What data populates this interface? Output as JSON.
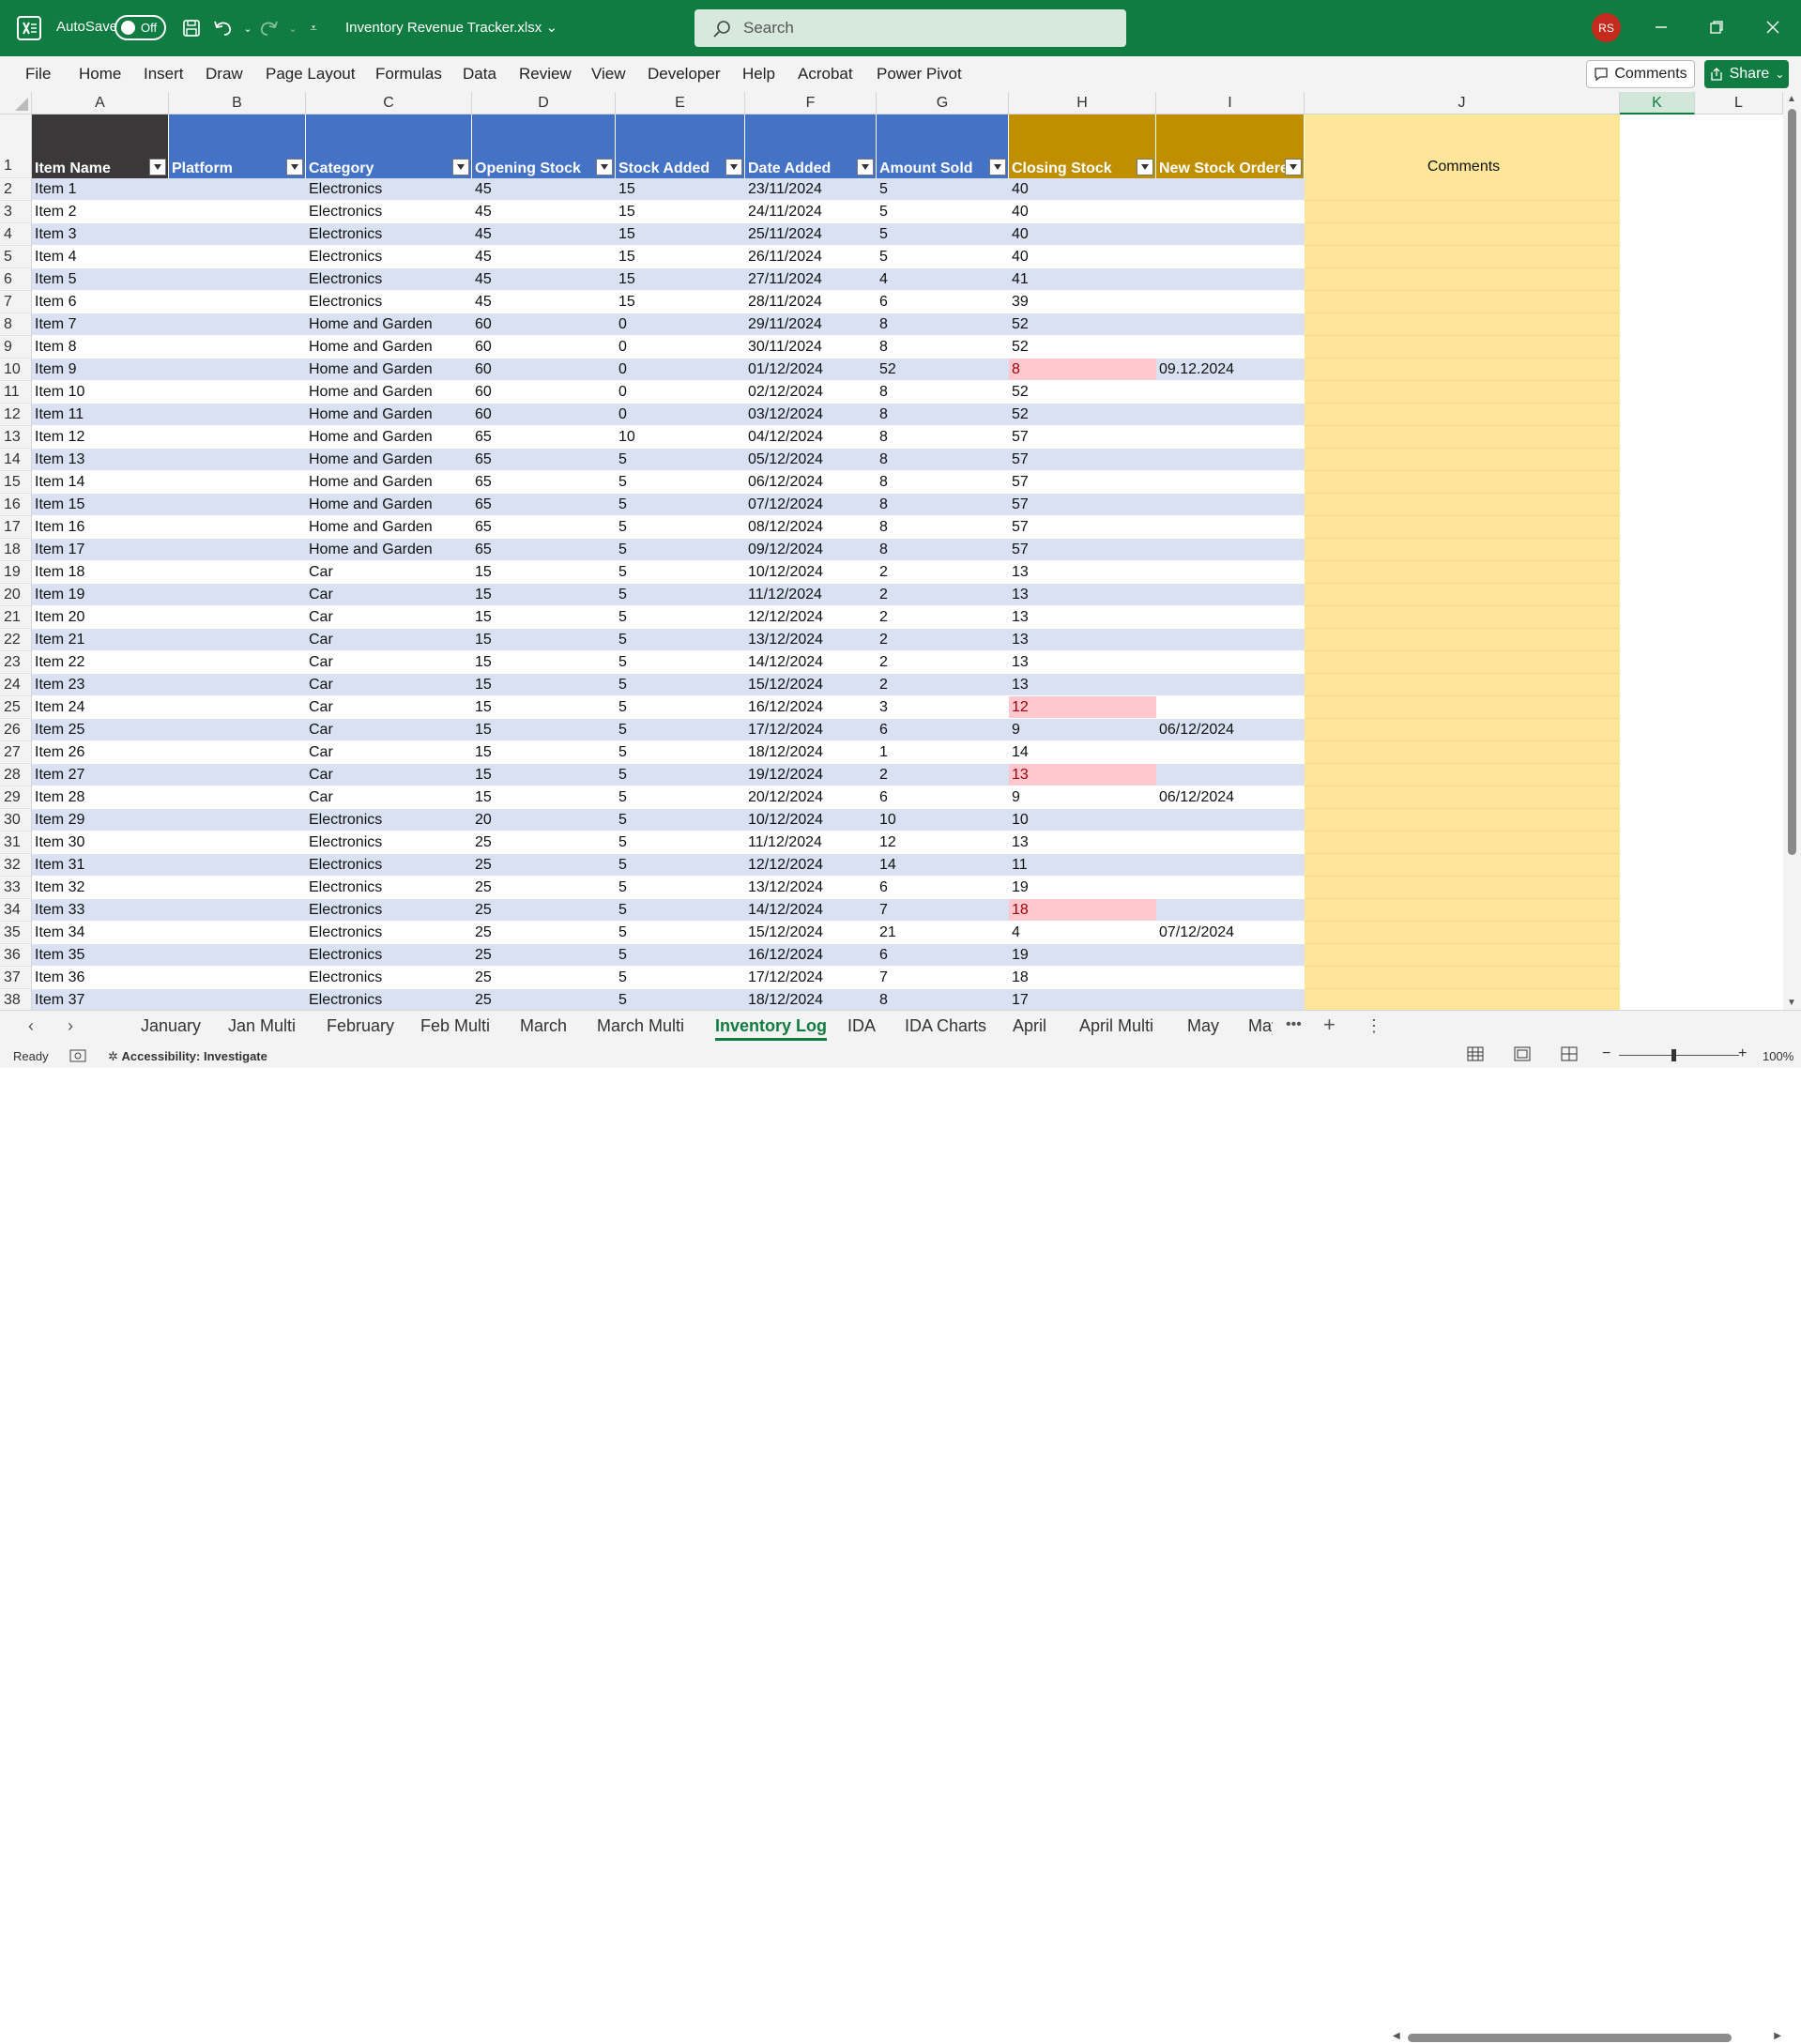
{
  "app": {
    "autosave_label": "AutoSave",
    "autosave_state": "Off",
    "filename": "Inventory Revenue Tracker.xlsx",
    "search_placeholder": "Search",
    "user_initials": "RS"
  },
  "menu": {
    "items": [
      "File",
      "Home",
      "Insert",
      "Draw",
      "Page Layout",
      "Formulas",
      "Data",
      "Review",
      "View",
      "Developer",
      "Help",
      "Acrobat",
      "Power Pivot"
    ],
    "comments_label": "Comments",
    "share_label": "Share"
  },
  "grid": {
    "column_letters": [
      "A",
      "B",
      "C",
      "D",
      "E",
      "F",
      "G",
      "H",
      "I",
      "J",
      "K",
      "L"
    ],
    "selected_column": "K",
    "headers": [
      "Item Name",
      "Platform",
      "Category",
      "Opening Stock",
      "Stock Added",
      "Date Added",
      "Amount Sold",
      "Closing Stock",
      "New Stock Ordered",
      "Comments"
    ],
    "rows": [
      [
        "Item 1",
        "",
        "Electronics",
        "45",
        "15",
        "23/11/2024",
        "5",
        "40",
        ""
      ],
      [
        "Item 2",
        "",
        "Electronics",
        "45",
        "15",
        "24/11/2024",
        "5",
        "40",
        ""
      ],
      [
        "Item 3",
        "",
        "Electronics",
        "45",
        "15",
        "25/11/2024",
        "5",
        "40",
        ""
      ],
      [
        "Item 4",
        "",
        "Electronics",
        "45",
        "15",
        "26/11/2024",
        "5",
        "40",
        ""
      ],
      [
        "Item 5",
        "",
        "Electronics",
        "45",
        "15",
        "27/11/2024",
        "4",
        "41",
        ""
      ],
      [
        "Item 6",
        "",
        "Electronics",
        "45",
        "15",
        "28/11/2024",
        "6",
        "39",
        ""
      ],
      [
        "Item 7",
        "",
        "Home and Garden",
        "60",
        "0",
        "29/11/2024",
        "8",
        "52",
        ""
      ],
      [
        "Item 8",
        "",
        "Home and Garden",
        "60",
        "0",
        "30/11/2024",
        "8",
        "52",
        ""
      ],
      [
        "Item 9",
        "",
        "Home and Garden",
        "60",
        "0",
        "01/12/2024",
        "52",
        "8",
        "09.12.2024"
      ],
      [
        "Item 10",
        "",
        "Home and Garden",
        "60",
        "0",
        "02/12/2024",
        "8",
        "52",
        ""
      ],
      [
        "Item 11",
        "",
        "Home and Garden",
        "60",
        "0",
        "03/12/2024",
        "8",
        "52",
        ""
      ],
      [
        "Item 12",
        "",
        "Home and Garden",
        "65",
        "10",
        "04/12/2024",
        "8",
        "57",
        ""
      ],
      [
        "Item 13",
        "",
        "Home and Garden",
        "65",
        "5",
        "05/12/2024",
        "8",
        "57",
        ""
      ],
      [
        "Item 14",
        "",
        "Home and Garden",
        "65",
        "5",
        "06/12/2024",
        "8",
        "57",
        ""
      ],
      [
        "Item 15",
        "",
        "Home and Garden",
        "65",
        "5",
        "07/12/2024",
        "8",
        "57",
        ""
      ],
      [
        "Item 16",
        "",
        "Home and Garden",
        "65",
        "5",
        "08/12/2024",
        "8",
        "57",
        ""
      ],
      [
        "Item 17",
        "",
        "Home and Garden",
        "65",
        "5",
        "09/12/2024",
        "8",
        "57",
        ""
      ],
      [
        "Item 18",
        "",
        "Car",
        "15",
        "5",
        "10/12/2024",
        "2",
        "13",
        ""
      ],
      [
        "Item 19",
        "",
        "Car",
        "15",
        "5",
        "11/12/2024",
        "2",
        "13",
        ""
      ],
      [
        "Item 20",
        "",
        "Car",
        "15",
        "5",
        "12/12/2024",
        "2",
        "13",
        ""
      ],
      [
        "Item 21",
        "",
        "Car",
        "15",
        "5",
        "13/12/2024",
        "2",
        "13",
        ""
      ],
      [
        "Item 22",
        "",
        "Car",
        "15",
        "5",
        "14/12/2024",
        "2",
        "13",
        ""
      ],
      [
        "Item 23",
        "",
        "Car",
        "15",
        "5",
        "15/12/2024",
        "2",
        "13",
        ""
      ],
      [
        "Item 24",
        "",
        "Car",
        "15",
        "5",
        "16/12/2024",
        "3",
        "12",
        ""
      ],
      [
        "Item 25",
        "",
        "Car",
        "15",
        "5",
        "17/12/2024",
        "6",
        "9",
        "06/12/2024"
      ],
      [
        "Item 26",
        "",
        "Car",
        "15",
        "5",
        "18/12/2024",
        "1",
        "14",
        ""
      ],
      [
        "Item 27",
        "",
        "Car",
        "15",
        "5",
        "19/12/2024",
        "2",
        "13",
        ""
      ],
      [
        "Item 28",
        "",
        "Car",
        "15",
        "5",
        "20/12/2024",
        "6",
        "9",
        "06/12/2024"
      ],
      [
        "Item 29",
        "",
        "Electronics",
        "20",
        "5",
        "10/12/2024",
        "10",
        "10",
        ""
      ],
      [
        "Item 30",
        "",
        "Electronics",
        "25",
        "5",
        "11/12/2024",
        "12",
        "13",
        ""
      ],
      [
        "Item 31",
        "",
        "Electronics",
        "25",
        "5",
        "12/12/2024",
        "14",
        "11",
        ""
      ],
      [
        "Item 32",
        "",
        "Electronics",
        "25",
        "5",
        "13/12/2024",
        "6",
        "19",
        ""
      ],
      [
        "Item 33",
        "",
        "Electronics",
        "25",
        "5",
        "14/12/2024",
        "7",
        "18",
        ""
      ],
      [
        "Item 34",
        "",
        "Electronics",
        "25",
        "5",
        "15/12/2024",
        "21",
        "4",
        "07/12/2024"
      ],
      [
        "Item 35",
        "",
        "Electronics",
        "25",
        "5",
        "16/12/2024",
        "6",
        "19",
        ""
      ],
      [
        "Item 36",
        "",
        "Electronics",
        "25",
        "5",
        "17/12/2024",
        "7",
        "18",
        ""
      ],
      [
        "Item 37",
        "",
        "Electronics",
        "25",
        "5",
        "18/12/2024",
        "8",
        "17",
        ""
      ]
    ],
    "low_stock_rows": [
      8,
      23,
      26,
      32
    ]
  },
  "sheet_tabs": [
    "January",
    "Jan Multi",
    "February",
    "Feb Multi",
    "March",
    "March Multi",
    "Inventory Log",
    "IDA",
    "IDA Charts",
    "April",
    "April Multi",
    "May",
    "May"
  ],
  "active_tab": "Inventory Log",
  "status": {
    "ready": "Ready",
    "accessibility": "Accessibility: Investigate",
    "zoom": "100%"
  },
  "colors": {
    "excel_green": "#107c41",
    "header_blue": "#4472c4",
    "header_dark": "#3a3838",
    "header_gold": "#bf8f00",
    "band_blue": "#d9e1f2",
    "comments_yellow": "#ffe699",
    "low_stock_pink": "#ffc7ce",
    "low_stock_text": "#9c0006"
  }
}
